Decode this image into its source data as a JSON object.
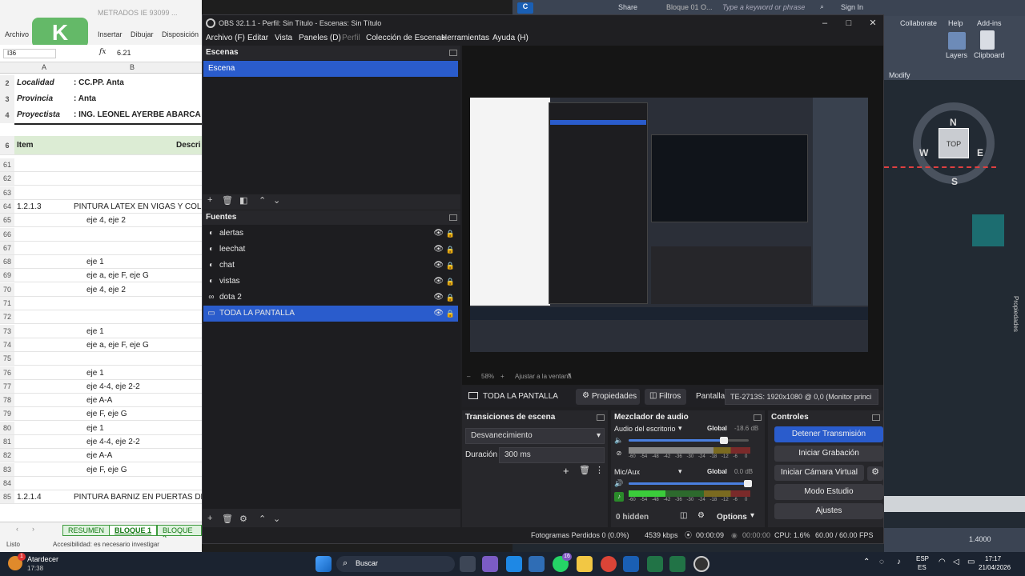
{
  "excel": {
    "title": "METRADOS IE 93099 ... ",
    "menu": [
      "Archivo",
      "Insertar",
      "Dibujar",
      "Disposición"
    ],
    "logo": "K",
    "cell_ref": "I36",
    "formula_value": "6.21",
    "fx": "fx",
    "col_a": "A",
    "col_b": "B",
    "header_rows": [
      {
        "num": "2",
        "label": "Localidad",
        "value": ": CC.PP. Anta"
      },
      {
        "num": "3",
        "label": "Provincia",
        "value": ": Anta"
      },
      {
        "num": "4",
        "label": "Proyectista",
        "value": ": ING. LEONEL AYERBE ABARCA"
      }
    ],
    "table_header": {
      "num": "6",
      "item": "Item",
      "desc": "Descri"
    },
    "rows": [
      {
        "num": "61",
        "a": "",
        "b": ""
      },
      {
        "num": "62",
        "a": "",
        "b": ""
      },
      {
        "num": "63",
        "a": "",
        "b": ""
      },
      {
        "num": "64",
        "a": "1.2.1.3",
        "b": "PINTURA LATEX EN VIGAS Y COLUM"
      },
      {
        "num": "65",
        "a": "",
        "b": "eje 4, eje 2"
      },
      {
        "num": "66",
        "a": "",
        "b": ""
      },
      {
        "num": "67",
        "a": "",
        "b": ""
      },
      {
        "num": "68",
        "a": "",
        "b": "eje 1"
      },
      {
        "num": "69",
        "a": "",
        "b": "eje a, eje F, eje G"
      },
      {
        "num": "70",
        "a": "",
        "b": "eje 4, eje 2"
      },
      {
        "num": "71",
        "a": "",
        "b": ""
      },
      {
        "num": "72",
        "a": "",
        "b": ""
      },
      {
        "num": "73",
        "a": "",
        "b": "eje 1"
      },
      {
        "num": "74",
        "a": "",
        "b": "eje a, eje F, eje G"
      },
      {
        "num": "75",
        "a": "",
        "b": ""
      },
      {
        "num": "76",
        "a": "",
        "b": "eje 1"
      },
      {
        "num": "77",
        "a": "",
        "b": "eje 4-4, eje 2-2"
      },
      {
        "num": "78",
        "a": "",
        "b": "eje A-A"
      },
      {
        "num": "79",
        "a": "",
        "b": "eje F, eje G"
      },
      {
        "num": "80",
        "a": "",
        "b": "eje 1"
      },
      {
        "num": "81",
        "a": "",
        "b": "eje 4-4, eje 2-2"
      },
      {
        "num": "82",
        "a": "",
        "b": "eje A-A"
      },
      {
        "num": "83",
        "a": "",
        "b": "eje F, eje G"
      },
      {
        "num": "84",
        "a": "",
        "b": ""
      },
      {
        "num": "85",
        "a": "1.2.1.4",
        "b": "PINTURA BARNIZ EN PUERTAS DE M"
      }
    ],
    "sheets": [
      "RESUMEN",
      "BLOQUE 1",
      "BLOQUE 2"
    ],
    "status_ready": "Listo",
    "status_access": "Accesibilidad: es necesario investigar"
  },
  "acad": {
    "title": "Bloque 01 O...",
    "search_placeholder": "Type a keyword or phrase",
    "share": "Share",
    "sign_in": "Sign In",
    "tabs": [
      "Collaborate",
      "Help",
      "Add-ins"
    ],
    "layers": "Layers",
    "clipboard": "Clipboard",
    "modify": "Modify",
    "compass": {
      "n": "N",
      "s": "S",
      "e": "E",
      "w": "W",
      "top": "TOP"
    },
    "zoom_scale": "1.4000",
    "properties": "Propiedades"
  },
  "obs": {
    "title": "OBS 32.1.1 - Perfil: Sin Título - Escenas: Sin Título",
    "menu": [
      {
        "label": "Archivo (F)",
        "dim": false
      },
      {
        "label": "Editar",
        "dim": false
      },
      {
        "label": "Vista",
        "dim": false
      },
      {
        "label": "Paneles (D)",
        "dim": false
      },
      {
        "label": "Perfil",
        "dim": true
      },
      {
        "label": "Colección de Escenas",
        "dim": false
      },
      {
        "label": "Herramientas",
        "dim": false
      },
      {
        "label": "Ayuda (H)",
        "dim": false
      }
    ],
    "scenes_title": "Escenas",
    "scenes": [
      "Escena"
    ],
    "sources_title": "Fuentes",
    "sources": [
      {
        "label": "alertas",
        "icon": "browser-icon"
      },
      {
        "label": "leechat",
        "icon": "browser-icon"
      },
      {
        "label": "chat",
        "icon": "browser-icon"
      },
      {
        "label": "vistas",
        "icon": "browser-icon"
      },
      {
        "label": "dota 2",
        "icon": "link-icon"
      },
      {
        "label": "TODA LA PANTALLA",
        "icon": "monitor-icon"
      }
    ],
    "zoom_label": "58%",
    "fit_label": "Ajustar a la ventana",
    "selected_source": "TODA LA PANTALLA",
    "properties_btn": "Propiedades",
    "filters_btn": "Filtros",
    "display_label": "Pantalla",
    "display_value": "TE-2713S: 1920x1080 @ 0,0 (Monitor princi",
    "transitions": {
      "title": "Transiciones de escena",
      "selected": "Desvanecimiento",
      "duration_label": "Duración",
      "duration_value": "300 ms"
    },
    "mixer": {
      "title": "Mezclador de audio",
      "channels": [
        {
          "name": "Audio del escritorio",
          "badge": "Global",
          "db": "-18.6 dB",
          "volume": 0.8
        },
        {
          "name": "Mic/Aux",
          "badge": "Global",
          "db": "0.0 dB",
          "volume": 1.0
        }
      ],
      "scale": [
        "-60",
        "-54",
        "-48",
        "-42",
        "-36",
        "-30",
        "-24",
        "-18",
        "-12",
        "-6",
        "0"
      ],
      "hidden": "0 hidden",
      "options": "Options"
    },
    "controls": {
      "title": "Controles",
      "stop_stream": "Detener Transmisión",
      "start_recording": "Iniciar Grabación",
      "start_virtual_cam": "Iniciar Cámara Virtual",
      "studio_mode": "Modo Estudio",
      "settings": "Ajustes"
    },
    "status": {
      "dropped": "Fotogramas Perdidos 0 (0.0%)",
      "bitrate": "4539 kbps",
      "stream_time": "00:00:09",
      "rec_time": "00:00:00",
      "cpu": "CPU: 1.6%",
      "fps": "60.00 / 60.00 FPS"
    }
  },
  "taskbar": {
    "weather_title": "Atardecer",
    "weather_time": "17:38",
    "search": "Buscar",
    "lang1": "ESP",
    "lang2": "ES",
    "clock_time": "17:17",
    "clock_date": "21/04/2026",
    "whatsapp_badge": "16",
    "weather_badge": "1"
  },
  "colors": {
    "accent": "#2a5ccc",
    "meter_green": "#3bcc3b",
    "excel_green": "#217346"
  }
}
